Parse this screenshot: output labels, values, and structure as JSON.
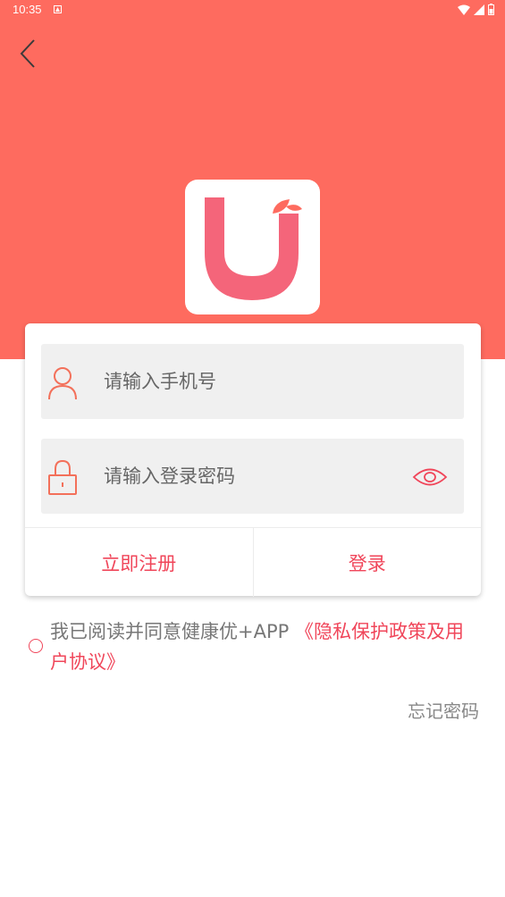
{
  "status_bar": {
    "time": "10:35",
    "icons": [
      "notification-icon",
      "wifi-icon",
      "signal-icon",
      "battery-icon"
    ]
  },
  "header": {
    "back_icon": "chevron-left-icon",
    "background_color": "#fe6b5f"
  },
  "logo": {
    "letter": "U",
    "color": "#f4657a",
    "leaf_color": "#fe6b5f"
  },
  "login_form": {
    "phone": {
      "icon": "user-icon",
      "value": "",
      "placeholder": "请输入手机号"
    },
    "password": {
      "icon": "lock-icon",
      "value": "",
      "placeholder": "请输入登录密码",
      "toggle_icon": "eye-icon"
    },
    "register_label": "立即注册",
    "login_label": "登录",
    "accent_color": "#f0465a"
  },
  "agreement": {
    "checked": false,
    "text": "我已阅读并同意健康优+APP ",
    "link_text": "《隐私保护政策及用户协议》"
  },
  "forgot_password_label": "忘记密码"
}
